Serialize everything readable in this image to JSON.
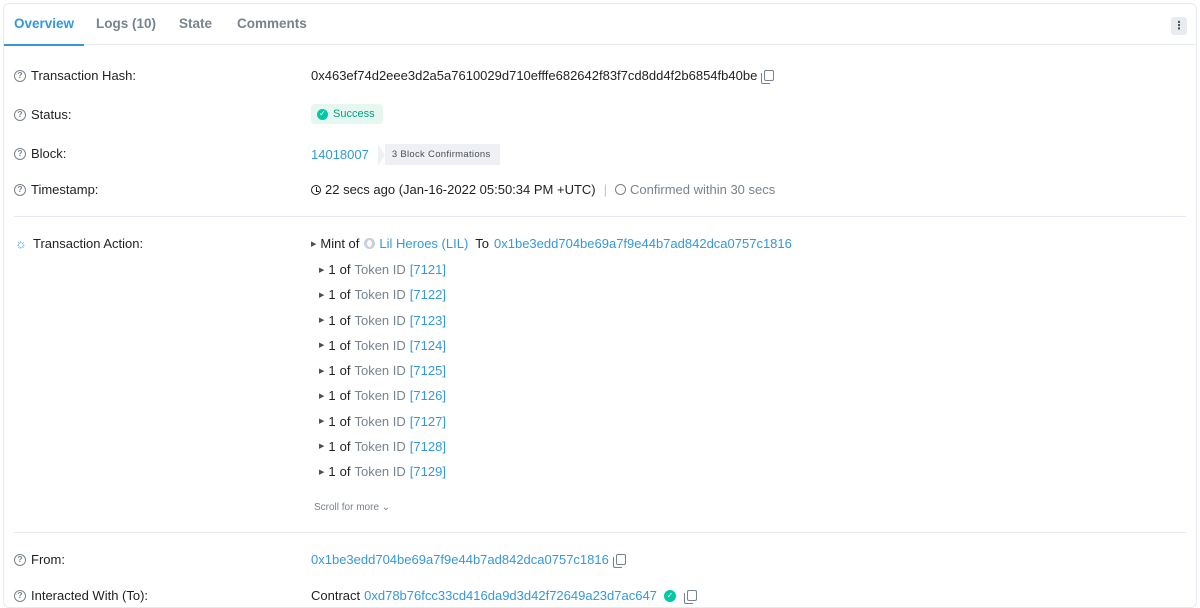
{
  "tabs": [
    {
      "label": "Overview"
    },
    {
      "label": "Logs (10)"
    },
    {
      "label": "State"
    },
    {
      "label": "Comments"
    }
  ],
  "more_icon": "⋮",
  "tx_hash": {
    "label": "Transaction Hash:",
    "value": "0x463ef74d2eee3d2a5a7610029d710efffe682642f83f7cd8dd4f2b6854fb40be"
  },
  "status": {
    "label": "Status:",
    "value": "Success"
  },
  "block": {
    "label": "Block:",
    "number": "14018007",
    "confirmations": "3 Block Confirmations"
  },
  "timestamp": {
    "label": "Timestamp:",
    "value": "22 secs ago (Jan-16-2022 05:50:34 PM +UTC)",
    "confirmed": "Confirmed within 30 secs"
  },
  "action": {
    "label": "Transaction Action:",
    "mint_prefix": "Mint of",
    "token_name": "Lil Heroes (LIL)",
    "to_label": "To",
    "to_address": "0x1be3edd704be69a7f9e44b7ad842dca0757c1816",
    "items": [
      {
        "qty": "1",
        "of": "of",
        "token_label": "Token ID",
        "token_id": "[7121]"
      },
      {
        "qty": "1",
        "of": "of",
        "token_label": "Token ID",
        "token_id": "[7122]"
      },
      {
        "qty": "1",
        "of": "of",
        "token_label": "Token ID",
        "token_id": "[7123]"
      },
      {
        "qty": "1",
        "of": "of",
        "token_label": "Token ID",
        "token_id": "[7124]"
      },
      {
        "qty": "1",
        "of": "of",
        "token_label": "Token ID",
        "token_id": "[7125]"
      },
      {
        "qty": "1",
        "of": "of",
        "token_label": "Token ID",
        "token_id": "[7126]"
      },
      {
        "qty": "1",
        "of": "of",
        "token_label": "Token ID",
        "token_id": "[7127]"
      },
      {
        "qty": "1",
        "of": "of",
        "token_label": "Token ID",
        "token_id": "[7128]"
      },
      {
        "qty": "1",
        "of": "of",
        "token_label": "Token ID",
        "token_id": "[7129]"
      }
    ],
    "scroll_more": "Scroll for more"
  },
  "from": {
    "label": "From:",
    "value": "0x1be3edd704be69a7f9e44b7ad842dca0757c1816"
  },
  "interacted": {
    "label": "Interacted With (To):",
    "prefix": "Contract",
    "value": "0xd78b76fcc33cd416da9d3d42f72649a23d7ac647"
  },
  "colors": {
    "accent": "#3498db",
    "success": "#00c9a7",
    "muted": "#77838f"
  }
}
